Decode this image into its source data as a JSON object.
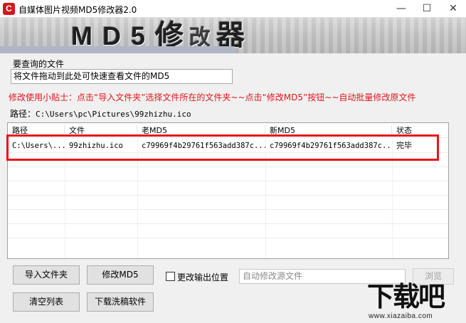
{
  "window": {
    "title": "自媒体图片视频MD5修改器2.0",
    "app_icon_glyph": "C",
    "controls": {
      "minimize": "—",
      "maximize": "☐",
      "close": "✕"
    }
  },
  "banner": {
    "md5": "MD5",
    "char1": "修",
    "char2": "改",
    "char3": "器"
  },
  "query": {
    "label": "要查询的文件",
    "value": "将文件拖动到此处可快速查看文件的MD5"
  },
  "tip": "修改使用小贴士：点击“导入文件夹”选择文件所在的文件夹~~点击“修改MD5”按钮~~自动批量修改原文件",
  "path": {
    "label": "路径：",
    "value": "C:\\Users\\pc\\Pictures\\99zhizhu.ico"
  },
  "table": {
    "columns": [
      "路径",
      "文件",
      "老MD5",
      "新MD5",
      "状态"
    ],
    "rows": [
      {
        "path": "C:\\Users\\...",
        "file": "99zhizhu.ico",
        "old_md5": "c79969f4b29761f563add387c...",
        "new_md5": "c79969f4b29761f563add387c...",
        "status": "完毕"
      }
    ]
  },
  "buttons": {
    "import_folder": "导入文件夹",
    "modify_md5": "修改MD5",
    "clear_list": "清空列表",
    "download": "下载洗稿软件",
    "browse": "浏览"
  },
  "output": {
    "checkbox_label": "更改输出位置",
    "checked": false,
    "placeholder": "自动修改源文件"
  },
  "watermark": {
    "big": "下载吧",
    "small": "www.xiazaiba.com"
  },
  "colors": {
    "accent_red": "#e8141c",
    "tip_red": "#e0141c"
  }
}
